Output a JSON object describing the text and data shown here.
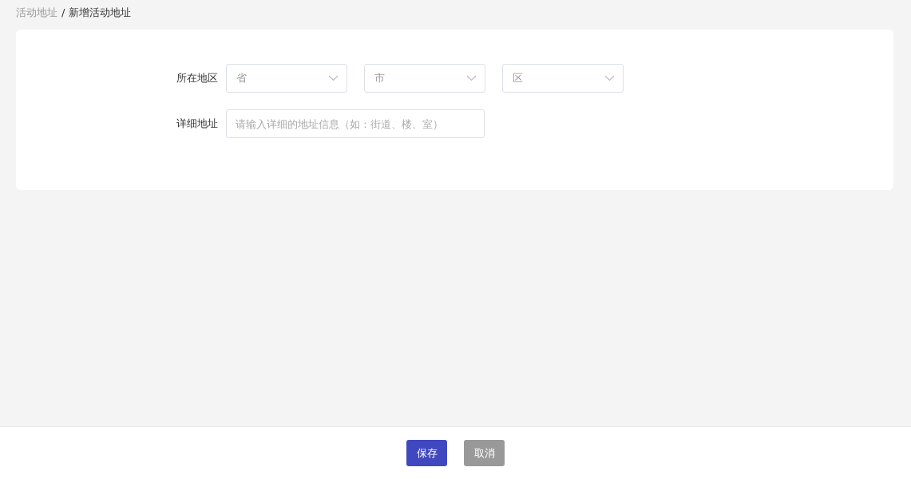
{
  "breadcrumb": [
    {
      "label": "活动地址",
      "current": false
    },
    {
      "label": "新增活动地址",
      "current": true
    }
  ],
  "breadcrumb_separator": "/",
  "form": {
    "region": {
      "label": "所在地区",
      "selects": [
        {
          "placeholder": "省"
        },
        {
          "placeholder": "市"
        },
        {
          "placeholder": "区"
        }
      ]
    },
    "address": {
      "label": "详细地址",
      "placeholder": "请输入详细的地址信息（如：街道、楼、室）"
    }
  },
  "buttons": [
    {
      "label": "保存",
      "kind": "primary"
    },
    {
      "label": "取消",
      "kind": "secondary"
    }
  ]
}
